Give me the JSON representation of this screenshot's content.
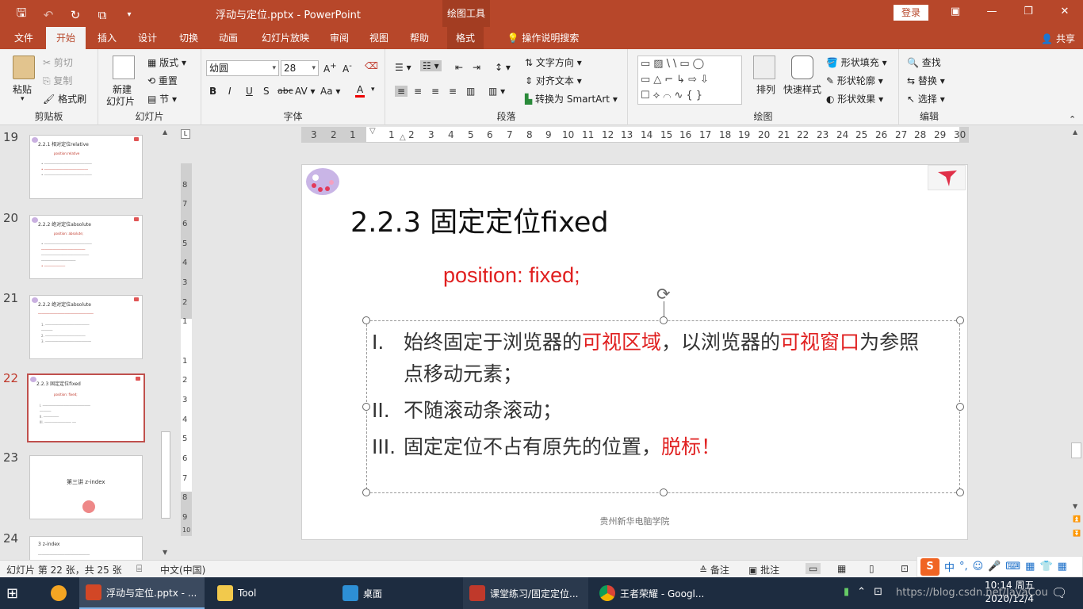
{
  "titlebar": {
    "doc_title": "浮动与定位.pptx  -  PowerPoint",
    "tools_context": "绘图工具",
    "login": "登录",
    "save_icon": "save-icon",
    "undo_icon": "undo-icon",
    "redo_icon": "redo-icon",
    "present_icon": "present-icon"
  },
  "tabs": {
    "items": [
      "文件",
      "开始",
      "插入",
      "设计",
      "切换",
      "动画",
      "幻灯片放映",
      "审阅",
      "视图",
      "帮助",
      "格式"
    ],
    "active": "开始",
    "tell_me": "操作说明搜索",
    "share": "共享"
  },
  "ribbon": {
    "clipboard": {
      "label": "剪贴板",
      "paste": "粘贴",
      "cut": "剪切",
      "copy": "复制",
      "format_painter": "格式刷"
    },
    "slides": {
      "label": "幻灯片",
      "new_slide_1": "新建",
      "new_slide_2": "幻灯片",
      "layout": "版式",
      "reset": "重置",
      "section": "节"
    },
    "font": {
      "label": "字体",
      "font_name": "幼圆",
      "font_size": "28"
    },
    "paragraph": {
      "label": "段落",
      "text_direction": "文字方向",
      "align_text": "对齐文本",
      "smartart": "转换为 SmartArt"
    },
    "drawing": {
      "label": "绘图",
      "arrange": "排列",
      "quick_styles": "快速样式",
      "shape_fill": "形状填充",
      "shape_outline": "形状轮廓",
      "shape_effects": "形状效果"
    },
    "editing": {
      "label": "编辑",
      "find": "查找",
      "replace": "替换",
      "select": "选择"
    }
  },
  "thumbnails": [
    {
      "num": "19",
      "title": "2.2.1 相对定位relative",
      "sub": "position:relative"
    },
    {
      "num": "20",
      "title": "2.2.2 绝对定位absolute",
      "sub": "position: absolute;"
    },
    {
      "num": "21",
      "title": "2.2.2 绝对定位absolute",
      "sub": ""
    },
    {
      "num": "22",
      "title": "2.2.3 固定定位fixed",
      "sub": "position: fixed;"
    },
    {
      "num": "23",
      "title": "第三讲  z-index",
      "sub": ""
    },
    {
      "num": "24",
      "title": "3 z-index",
      "sub": ""
    }
  ],
  "current_slide": "22",
  "hruler_numbers": [
    "3",
    "2",
    "1",
    "1",
    "2",
    "3",
    "4",
    "5",
    "6",
    "7",
    "8",
    "9",
    "10",
    "11",
    "12",
    "13",
    "14",
    "15",
    "16",
    "17",
    "18",
    "19",
    "20",
    "21",
    "22",
    "23",
    "24",
    "25",
    "26",
    "27",
    "28",
    "29",
    "30"
  ],
  "vruler_numbers": [
    "8",
    "7",
    "6",
    "5",
    "4",
    "3",
    "2",
    "1",
    "1",
    "2",
    "3",
    "4",
    "5",
    "6",
    "7",
    "8",
    "9",
    "10"
  ],
  "slide": {
    "title": "2.2.3 固定定位fixed",
    "code": "position: fixed;",
    "items": [
      {
        "num": "I.",
        "a": "始终固定于浏览器的",
        "b": "可视区域",
        "c": "，以浏览器的",
        "d": "可视窗口",
        "e": "为参照",
        "line2": "点移动元素；"
      },
      {
        "num": "II.",
        "text": "不随滚动条滚动；"
      },
      {
        "num": "III.",
        "text": "固定定位不占有原先的位置，",
        "red": "脱标！"
      }
    ],
    "footer": "贵州新华电脑学院"
  },
  "status": {
    "slide_info": "幻灯片 第 22 张，共 25 张",
    "language": "中文(中国)",
    "notes": "备注",
    "comments": "批注"
  },
  "taskbar": {
    "items": [
      "浮动与定位.pptx - ...",
      "Tool",
      "桌面",
      "课堂练习/固定定位...",
      "王者荣耀 - Googl..."
    ],
    "time": "10:14 周五",
    "date": "2020/12/4",
    "watermark": "https://blog.csdn.net/JayaCou"
  },
  "colors": {
    "accent": "#b7472a",
    "red_text": "#e02020"
  }
}
